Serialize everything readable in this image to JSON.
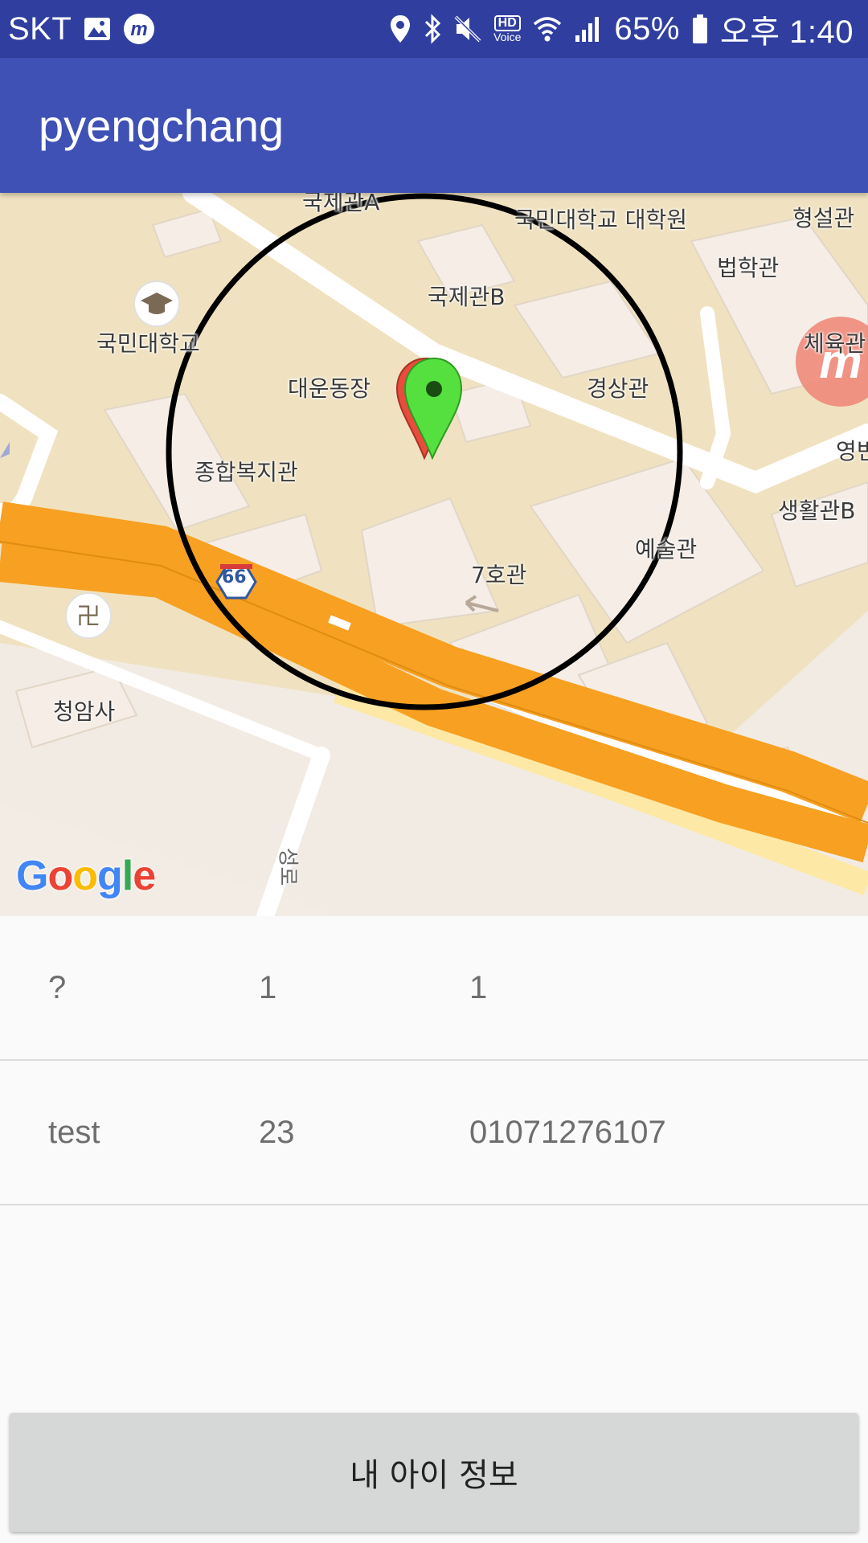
{
  "status_bar": {
    "carrier": "SKT",
    "hd_label": "HD",
    "voice_label": "Voice",
    "battery": "65%",
    "time": "오후 1:40",
    "icons": [
      "gallery-icon",
      "m-app-icon",
      "location-icon",
      "bluetooth-icon",
      "mute-icon",
      "hd-voice-icon",
      "wifi-icon",
      "signal-icon",
      "battery-icon"
    ]
  },
  "app_bar": {
    "title": "pyengchang"
  },
  "map": {
    "labels": {
      "intl_a": "국제관A",
      "grad_school": "국민대학교 대학원",
      "hyeongseol": "형설관",
      "law": "법학관",
      "intl_b": "국제관B",
      "kookmin": "국민대학교",
      "gym": "체육관",
      "stadium": "대운동장",
      "gyeongsang": "경상관",
      "welfare": "종합복지관",
      "yeongbin": "영빈",
      "life_b": "생활관B",
      "art": "예술관",
      "hall7": "7호관",
      "cheongam": "청암사",
      "road_sign": "66",
      "road_name": "성로"
    },
    "google_logo": [
      "G",
      "o",
      "o",
      "g",
      "l",
      "e"
    ],
    "marker_colors": {
      "green": "#4cd137",
      "red": "#e74c3c"
    },
    "circle_color": "#000000"
  },
  "list": {
    "rows": [
      {
        "name": "?",
        "age": "1",
        "phone": "1"
      },
      {
        "name": "test",
        "age": "23",
        "phone": "01071276107"
      }
    ]
  },
  "bottom_button": {
    "label": "내 아이 정보"
  },
  "colors": {
    "status_bar": "#303f9f",
    "app_bar": "#3f51b5",
    "button": "#d6d7d7"
  }
}
